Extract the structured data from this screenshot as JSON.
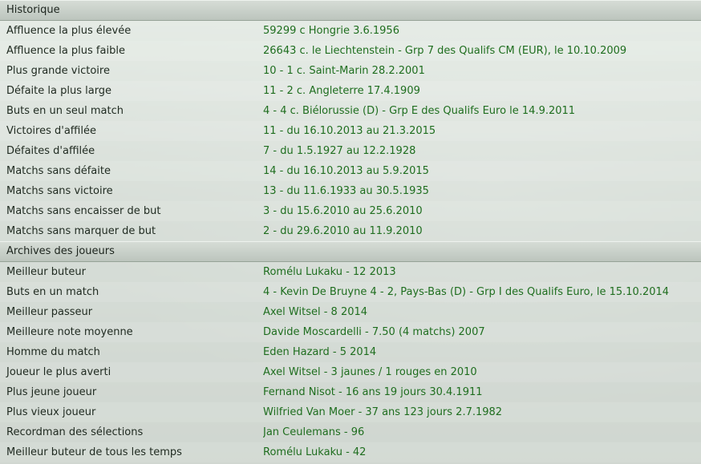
{
  "historique": {
    "title": "Historique",
    "rows": [
      {
        "label": "Affluence la plus élevée",
        "value": "59299 c Hongrie 3.6.1956"
      },
      {
        "label": "Affluence la plus faible",
        "value": "26643 c. le Liechtenstein - Grp 7 des Qualifs CM (EUR), le 10.10.2009"
      },
      {
        "label": "Plus grande victoire",
        "value": "10 - 1 c. Saint-Marin 28.2.2001"
      },
      {
        "label": "Défaite la plus large",
        "value": "11 - 2 c. Angleterre 17.4.1909"
      },
      {
        "label": "Buts en un seul match",
        "value": "4 - 4 c. Biélorussie (D) - Grp E des Qualifs Euro le 14.9.2011"
      },
      {
        "label": "Victoires d'affilée",
        "value": "11 - du 16.10.2013 au 21.3.2015"
      },
      {
        "label": "Défaites d'affilée",
        "value": "7 - du 1.5.1927 au 12.2.1928"
      },
      {
        "label": "Matchs sans défaite",
        "value": "14 - du 16.10.2013 au 5.9.2015"
      },
      {
        "label": "Matchs sans victoire",
        "value": "13 - du 11.6.1933 au 30.5.1935"
      },
      {
        "label": "Matchs sans encaisser de but",
        "value": "3 - du 15.6.2010 au 25.6.2010"
      },
      {
        "label": "Matchs sans marquer de but",
        "value": "2 - du 29.6.2010 au 11.9.2010"
      }
    ]
  },
  "archives": {
    "title": "Archives des joueurs",
    "rows": [
      {
        "label": "Meilleur buteur",
        "value": "Romélu Lukaku - 12 2013"
      },
      {
        "label": "Buts en un match",
        "value": "4 - Kevin De Bruyne 4 - 2, Pays-Bas (D) - Grp I des Qualifs Euro, le 15.10.2014"
      },
      {
        "label": "Meilleur passeur",
        "value": "Axel Witsel - 8 2014"
      },
      {
        "label": "Meilleure note moyenne",
        "value": "Davide Moscardelli - 7.50 (4 matchs) 2007"
      },
      {
        "label": "Homme du match",
        "value": "Eden Hazard - 5 2014"
      },
      {
        "label": "Joueur le plus averti",
        "value": "Axel Witsel - 3 jaunes / 1 rouges en 2010"
      },
      {
        "label": "Plus jeune joueur",
        "value": "Fernand Nisot - 16 ans 19 jours 30.4.1911"
      },
      {
        "label": "Plus vieux joueur",
        "value": "Wilfried Van Moer - 37 ans 123 jours 2.7.1982"
      },
      {
        "label": "Recordman des sélections",
        "value": "Jan Ceulemans - 96"
      },
      {
        "label": "Meilleur buteur de tous les temps",
        "value": "Romélu Lukaku - 42"
      }
    ]
  },
  "colors": {
    "value_text": "#1f6e1f",
    "label_text": "#1f2a20"
  }
}
